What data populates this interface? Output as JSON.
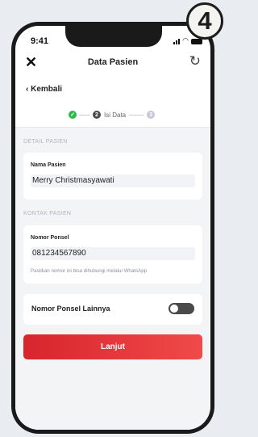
{
  "badge": "4",
  "status_bar": {
    "time": "9:41"
  },
  "header": {
    "title": "Data Pasien",
    "close_icon": "close-icon",
    "refresh_icon": "refresh-icon"
  },
  "nav": {
    "back_label": "Kembali"
  },
  "stepper": {
    "steps": [
      {
        "number": "",
        "label": "",
        "state": "done"
      },
      {
        "number": "2",
        "label": "Isi Data",
        "state": "active"
      },
      {
        "number": "3",
        "label": "",
        "state": "todo"
      }
    ]
  },
  "sections": {
    "patient_detail": {
      "label": "DETAIL PASIEN",
      "name_label": "Nama Pasien",
      "name_value": "Merry Christmasyawati"
    },
    "patient_contact": {
      "label": "KONTAK PASIEN",
      "phone_label": "Nomor Ponsel",
      "phone_value": "081234567890",
      "phone_hint": "Pastikan nomor ini bisa dihubungi melalui WhatsApp"
    },
    "other_phone": {
      "label": "Nomor Ponsel Lainnya",
      "enabled": false
    }
  },
  "cta": {
    "label": "Lanjut"
  },
  "colors": {
    "primary": "#e0282e",
    "success": "#2eb84e"
  }
}
